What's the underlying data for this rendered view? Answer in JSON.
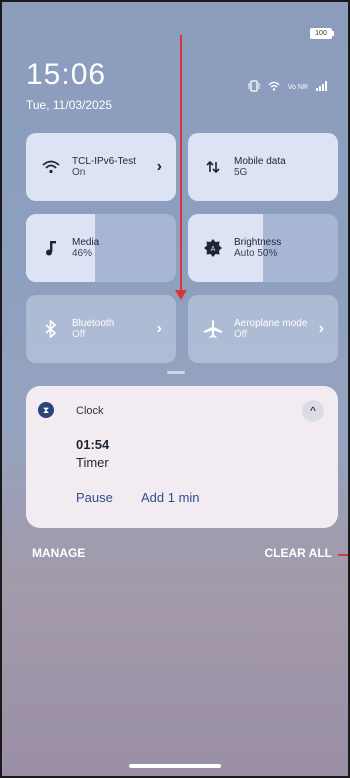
{
  "status": {
    "battery": "100",
    "time": "15:06",
    "date": "Tue, 11/03/2025",
    "network_label": "Vo NR"
  },
  "tiles": {
    "wifi": {
      "label": "TCL-IPv6-Test",
      "sub": "On"
    },
    "mobile": {
      "label": "Mobile data",
      "sub": "5G"
    },
    "media": {
      "label": "Media",
      "sub": "46%",
      "level": 0.46
    },
    "brightness": {
      "label": "Brightness",
      "sub": "Auto 50%",
      "level": 0.5
    },
    "bluetooth": {
      "label": "Bluetooth",
      "sub": "Off"
    },
    "aeroplane": {
      "label": "Aeroplane mode",
      "sub": "Off"
    }
  },
  "notification": {
    "app": "Clock",
    "title": "01:54",
    "text": "Timer",
    "actions": [
      "Pause",
      "Add 1 min"
    ]
  },
  "footer": {
    "manage": "MANAGE",
    "clear_all": "CLEAR ALL"
  },
  "colors": {
    "accent": "#2f4f8d",
    "annotation": "#d9343a"
  }
}
